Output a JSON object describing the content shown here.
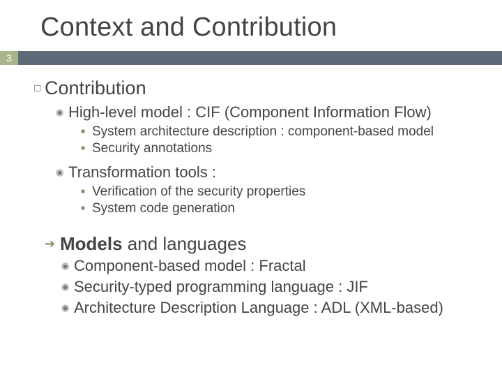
{
  "page_number": "3",
  "title": "Context and Contribution",
  "section1": {
    "heading": "Contribution",
    "item1": {
      "label": "High-level model : CIF (Component Information Flow)",
      "sub1": "System architecture description : component-based model",
      "sub2": "Security annotations"
    },
    "item2": {
      "label": "Transformation tools :",
      "sub1": "Verification of the security properties",
      "sub2": "System code generation"
    }
  },
  "section2": {
    "heading_prefix": "Models",
    "heading_rest": " and languages",
    "sub1": "Component-based model : Fractal",
    "sub2": "Security-typed programming language : JIF",
    "sub3": "Architecture Description Language : ADL (XML-based)"
  }
}
